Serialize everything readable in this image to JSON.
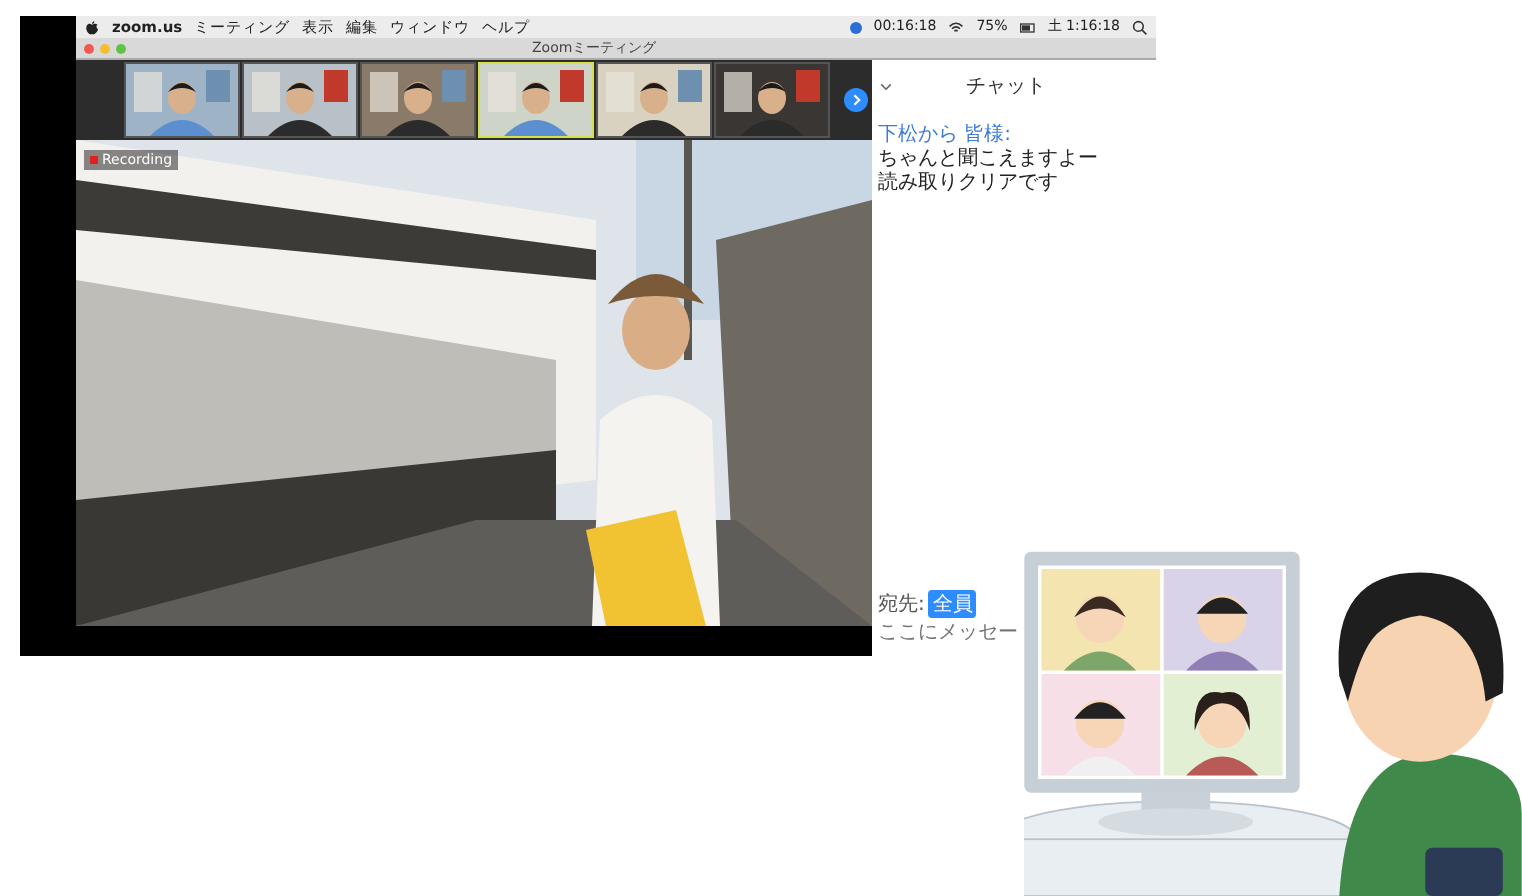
{
  "menu_bar": {
    "items": [
      "zoom.us",
      "ミーティング",
      "表示",
      "編集",
      "ウィンドウ",
      "ヘルプ"
    ],
    "timer": "00:16:18",
    "battery": "75%",
    "clock": "土 1:16:18"
  },
  "window": {
    "title": "Zoomミーティング"
  },
  "participants": [
    {
      "kind": "picture",
      "active": false
    },
    {
      "kind": "picture",
      "active": false
    },
    {
      "kind": "picture",
      "active": false
    },
    {
      "kind": "picture",
      "active": true
    },
    {
      "kind": "picture",
      "active": false
    },
    {
      "kind": "picture",
      "active": false
    }
  ],
  "video": {
    "recording_label": "Recording"
  },
  "chat": {
    "title": "チャット",
    "messages": [
      {
        "from": "下松から 皆様:",
        "lines": [
          "ちゃんと聞こえますよー",
          "読み取りクリアです"
        ]
      }
    ],
    "to_label": "宛先:",
    "to_value": "全員",
    "input_placeholder": "ここにメッセー"
  }
}
